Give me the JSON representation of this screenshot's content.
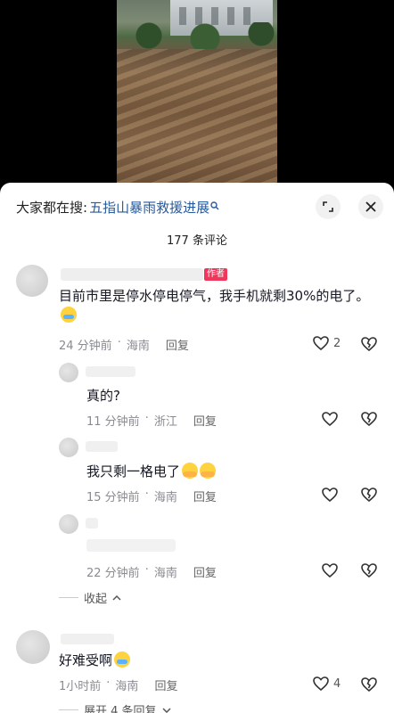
{
  "search": {
    "prefix": "大家都在搜:",
    "term": "五指山暴雨救援进展"
  },
  "header": {
    "count_label": "177 条评论"
  },
  "icons": {
    "expand": "expand-icon",
    "close": "close-icon",
    "heart": "heart-icon",
    "dislike": "broken-heart-icon"
  },
  "comments": [
    {
      "nickname": "",
      "badge": "作者",
      "text": "目前市里是停水停电停气，我手机就剩30%的电了。",
      "time": "24 分钟前",
      "location": "海南",
      "reply": "回复",
      "likes": "2",
      "replies": [
        {
          "text": "真的?",
          "time": "11 分钟前",
          "location": "浙江",
          "reply": "回复",
          "likes": ""
        },
        {
          "text": "我只剩一格电了",
          "time": "15 分钟前",
          "location": "海南",
          "reply": "回复",
          "likes": ""
        },
        {
          "text": "",
          "time": "22 分钟前",
          "location": "海南",
          "reply": "回复",
          "likes": ""
        }
      ],
      "collapse_label": "收起"
    },
    {
      "nickname": "",
      "text": "好难受啊",
      "time": "1小时前",
      "location": "海南",
      "reply": "回复",
      "likes": "4",
      "expand_label": "展开 4 条回复"
    }
  ]
}
